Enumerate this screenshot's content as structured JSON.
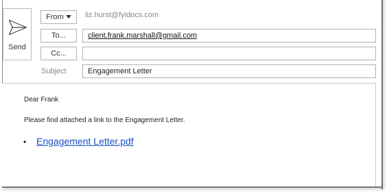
{
  "send": {
    "label": "Send",
    "icon": "send-icon"
  },
  "header": {
    "from_label": "From",
    "from_address": "liz.hurst@fyidocs.com",
    "to_label": "To...",
    "to_value": "client.frank.marshall@gmail.com",
    "cc_label": "Cc...",
    "cc_value": "",
    "subject_label": "Subject",
    "subject_value": "Engagement Letter"
  },
  "body": {
    "salutation": "Dear Frank",
    "message": "Please find attached a link to the Engagement Letter.",
    "attachment_link": "Engagement Letter.pdf"
  },
  "colors": {
    "link": "#1a4fc4",
    "muted_text": "#888888",
    "border": "#b0b0b0"
  }
}
